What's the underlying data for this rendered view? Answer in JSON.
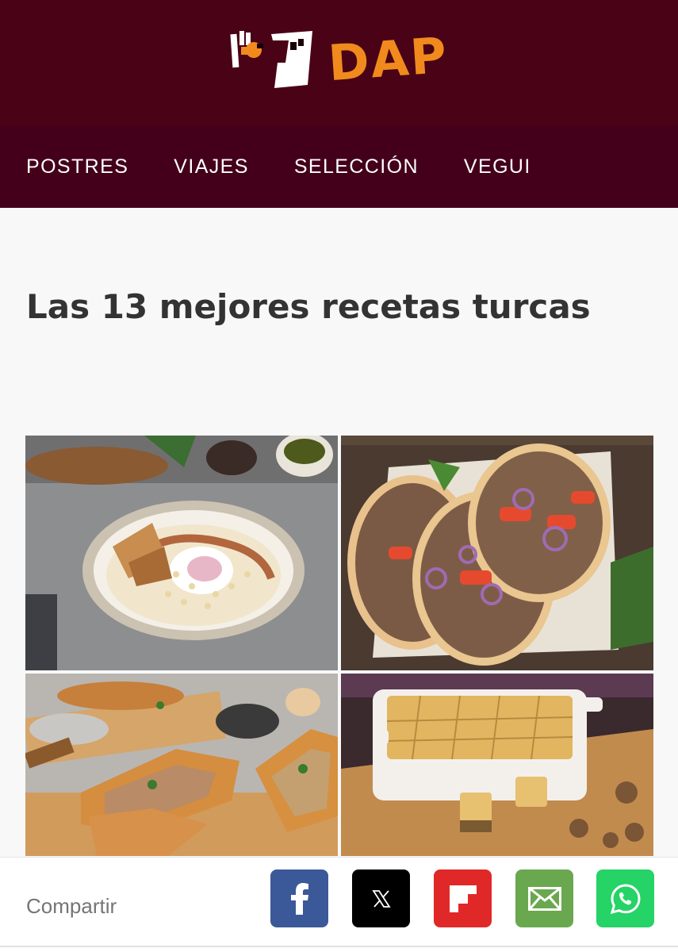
{
  "header": {
    "logo_text": "DAP",
    "background": "#4a0216",
    "accent": "#f08a1c"
  },
  "nav": {
    "items": [
      {
        "label": "POSTRES"
      },
      {
        "label": "VIAJES"
      },
      {
        "label": "SELECCIÓN"
      },
      {
        "label": "VEGUI"
      }
    ],
    "background": "#44001a"
  },
  "article": {
    "title": "Las 13 mejores recetas turcas",
    "images": [
      {
        "icon": "turkish-eggs-photo"
      },
      {
        "icon": "lahmacun-photo"
      },
      {
        "icon": "pide-photo"
      },
      {
        "icon": "baklava-photo"
      }
    ]
  },
  "share": {
    "label": "Compartir",
    "buttons": [
      {
        "name": "facebook",
        "color": "#3b5998",
        "icon": "facebook-icon"
      },
      {
        "name": "x",
        "color": "#000000",
        "icon": "x-icon"
      },
      {
        "name": "flipboard",
        "color": "#e12828",
        "icon": "flipboard-icon"
      },
      {
        "name": "email",
        "color": "#6aa84f",
        "icon": "mail-icon"
      },
      {
        "name": "whatsapp",
        "color": "#25d366",
        "icon": "whatsapp-icon"
      }
    ]
  }
}
